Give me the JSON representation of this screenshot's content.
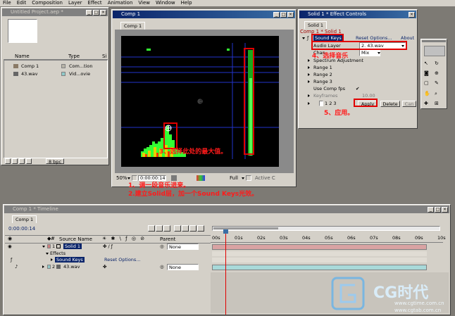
{
  "menu": [
    "File",
    "Edit",
    "Composition",
    "Layer",
    "Effect",
    "Animation",
    "View",
    "Window",
    "Help"
  ],
  "project": {
    "title": "Untitled Project.aep *",
    "col_name": "Name",
    "col_type": "Type",
    "col_size": "Si",
    "items": [
      {
        "name": "Comp 1",
        "type": "Com...tion"
      },
      {
        "name": "43.wav",
        "type": "Vid...ovie"
      }
    ],
    "bpc": "8 bpc"
  },
  "comp": {
    "title": "Comp 1",
    "tab": "Comp 1",
    "zoom": "50%",
    "timecode": "0:00:00:14",
    "resolution": "Full",
    "camera": "Active C"
  },
  "fx": {
    "title": "Solid 1 * Effect Controls",
    "tab": "Solid 1",
    "subtitle": "Comp 1 * Solid 1",
    "effect_name": "Sound Keys",
    "reset": "Reset Options...",
    "about": "About",
    "audio_layer_label": "Audio Layer",
    "audio_layer_value": "2. 43.wav",
    "channel_label": "Chan",
    "channel_value": "Mix",
    "props": [
      "Spectrum Adjustment",
      "Range 1",
      "Range 2",
      "Range 3"
    ],
    "use_comp_fps": "Use Comp fps",
    "keyframes_label": "Keyframes",
    "keyframes_value": "10.00",
    "slots": "1 2 3",
    "apply": "Apply",
    "delete": "Delete",
    "can": "Can"
  },
  "timeline": {
    "title": "Comp 1 * Timeline",
    "tab": "Comp 1",
    "time": "0:00:00:14",
    "col_source": "Source Name",
    "col_parent": "Parent",
    "none": "None",
    "rulers": [
      "00s",
      "01s",
      "02s",
      "03s",
      "04s",
      "05s",
      "06s",
      "07s",
      "08s",
      "09s",
      "10s"
    ],
    "layers": [
      {
        "num": "1",
        "name": "Solid 1"
      },
      {
        "num": "2",
        "name": "43.wav"
      }
    ],
    "effects_label": "Effects",
    "sound_keys": "Sound Keys",
    "reset_options": "Reset Options..."
  },
  "annotations": {
    "a1": "1、调一段音乐进来。",
    "a2": "2.建立Solid层，加一个Sound Keys光效。",
    "a3": "3、选择此处的最大值。",
    "a4": "4、选择音乐",
    "a5": "5、应用。"
  },
  "watermark": {
    "brand": "CG时代",
    "url1": "www.cgtime.com.cn",
    "url2": "www.cgtab.com.cn"
  },
  "colors": {
    "accent_red": "#e00000",
    "title_active": "#0a246a",
    "spectrum": "#33ff33"
  }
}
